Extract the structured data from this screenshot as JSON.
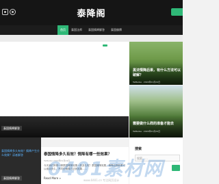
{
  "header": {
    "site_title": "泰降阁",
    "icons": [
      "instagram-icon",
      "wechat-icon"
    ]
  },
  "nav": {
    "items": [
      {
        "label": "首页",
        "active": true
      },
      {
        "label": "泰国法师",
        "active": false
      },
      {
        "label": "泰国情降解答",
        "active": false
      },
      {
        "label": "泰国佛牌",
        "active": false
      }
    ]
  },
  "slider": {
    "tag": "泰国情降解答"
  },
  "featured": [
    {
      "title": "黑法情降后果，有什么方法可以破解？",
      "author": "TaiBeiGe",
      "date": "2024年01月24日"
    },
    {
      "title": "需要做什么样的准备才能去",
      "author": "TaiBeiGe",
      "date": "2024年01月24日"
    }
  ],
  "lower_left": {
    "link": "泰国情降多久有效？情降产生什么效果？读者解答",
    "tag": "泰国情降解答"
  },
  "post": {
    "title": "泰国情降多久有效？情降有哪一些效果？",
    "meta": "TaiBeiGe  2024年01月24日",
    "excerpt": "今天我们来聊一聊泰国情降效果一般多久呢？泰国情降效果，情降后期效果可以维持多久，不同的情降方法其效果……",
    "read_more": "Read More »"
  },
  "sidebar": {
    "search_label": "搜索",
    "search_placeholder": "搜索……"
  },
  "watermark": {
    "text": "0401素材网",
    "sub": "www.0401.cn 专注网页设计"
  },
  "colors": {
    "accent": "#2fb877",
    "topbar": "#151515"
  }
}
